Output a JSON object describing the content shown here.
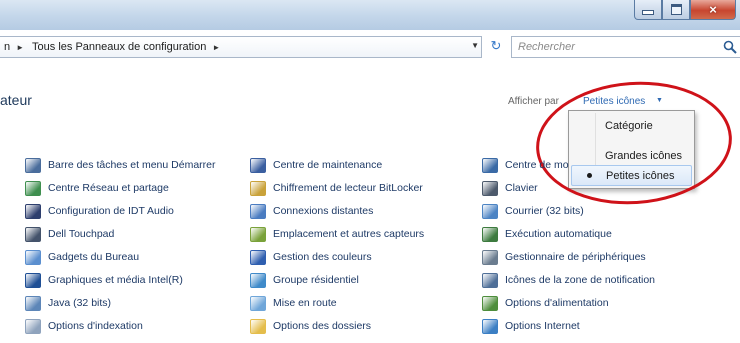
{
  "window": {
    "buttons": {
      "minimize": "minimize",
      "maximize": "maximize",
      "close": "×"
    }
  },
  "address": {
    "crumbs": [
      {
        "label": "n"
      },
      {
        "label": "Tous les Panneaux de configuration"
      }
    ],
    "separator": "►",
    "dropdown": "▼",
    "refresh": "↻"
  },
  "search": {
    "placeholder": "Rechercher"
  },
  "page": {
    "title_fragment": "ateur"
  },
  "view_by": {
    "label": "Afficher par",
    "value": "Petites icônes",
    "arrow": "▼"
  },
  "view_menu": {
    "items": [
      {
        "label": "Catégorie",
        "selected": false
      },
      {
        "label": "Grandes icônes",
        "selected": false
      },
      {
        "label": "Petites icônes",
        "selected": true
      }
    ]
  },
  "items": {
    "col1": [
      {
        "label": "Barre des tâches et menu Démarrer",
        "icon": "taskbar-icon",
        "color": "#4a6d9c"
      },
      {
        "label": "Centre Réseau et partage",
        "icon": "network-icon",
        "color": "#3f8f4f"
      },
      {
        "label": "Configuration de IDT Audio",
        "icon": "audio-icon",
        "color": "#2e3f6e"
      },
      {
        "label": "Dell Touchpad",
        "icon": "touchpad-icon",
        "color": "#44536b"
      },
      {
        "label": "Gadgets du Bureau",
        "icon": "gadgets-icon",
        "color": "#5b8fcf"
      },
      {
        "label": "Graphiques et média Intel(R)",
        "icon": "intel-graphics-icon",
        "color": "#1f4f95"
      },
      {
        "label": "Java (32 bits)",
        "icon": "java-icon",
        "color": "#5d86b8"
      },
      {
        "label": "Options d'indexation",
        "icon": "indexing-icon",
        "color": "#8fa3bd"
      }
    ],
    "col2": [
      {
        "label": "Centre de maintenance",
        "icon": "flag-icon",
        "color": "#3b5fa0"
      },
      {
        "label": "Chiffrement de lecteur BitLocker",
        "icon": "bitlocker-icon",
        "color": "#c9a23a"
      },
      {
        "label": "Connexions distantes",
        "icon": "remote-icon",
        "color": "#4a7cc1"
      },
      {
        "label": "Emplacement et autres capteurs",
        "icon": "sensor-icon",
        "color": "#7aa23a"
      },
      {
        "label": "Gestion des couleurs",
        "icon": "color-icon",
        "color": "#2f5fb0"
      },
      {
        "label": "Groupe résidentiel",
        "icon": "homegroup-icon",
        "color": "#3f8ac9"
      },
      {
        "label": "Mise en route",
        "icon": "getting-started-icon",
        "color": "#6fa6d9"
      },
      {
        "label": "Options des dossiers",
        "icon": "folder-icon",
        "color": "#e4bd4c"
      }
    ],
    "col3": [
      {
        "label": "Centre de mo",
        "icon": "mobility-icon",
        "color": "#3a6aa6"
      },
      {
        "label": "Clavier",
        "icon": "keyboard-icon",
        "color": "#4d5a6c"
      },
      {
        "label": "Courrier (32 bits)",
        "icon": "mail-icon",
        "color": "#4c84c4"
      },
      {
        "label": "Exécution automatique",
        "icon": "autoplay-icon",
        "color": "#3d7b3f"
      },
      {
        "label": "Gestionnaire de périphériques",
        "icon": "device-manager-icon",
        "color": "#6a7c8f"
      },
      {
        "label": "Icônes de la zone de notification",
        "icon": "notification-icon",
        "color": "#4f6f98"
      },
      {
        "label": "Options d'alimentation",
        "icon": "power-icon",
        "color": "#4e8e3c"
      },
      {
        "label": "Options Internet",
        "icon": "internet-options-icon",
        "color": "#3c7fc4"
      }
    ]
  }
}
